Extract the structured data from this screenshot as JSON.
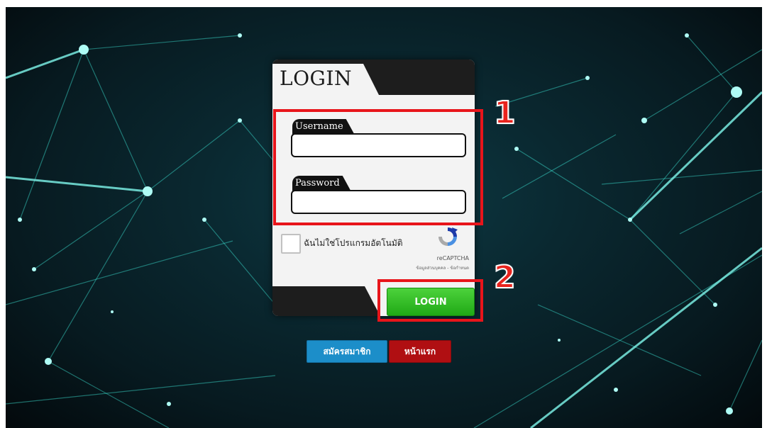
{
  "login": {
    "title": "LOGIN",
    "username_label": "Username",
    "username_value": "",
    "password_label": "Password",
    "password_value": "",
    "submit_label": "LOGIN"
  },
  "captcha": {
    "text": "ฉันไม่ใช่โปรแกรมอัตโนมัติ",
    "brand": "reCAPTCHA",
    "links": "ข้อมูลส่วนบุคคล - ข้อกำหนด"
  },
  "annotations": {
    "step1": "1",
    "step2": "2"
  },
  "links": {
    "register_label": "สมัครสมาชิก",
    "home_label": "หน้าแรก"
  },
  "colors": {
    "highlight": "#e8151b",
    "login_button": "#2cb81f",
    "register_button": "#1c8ec9",
    "home_button": "#b00f12"
  }
}
